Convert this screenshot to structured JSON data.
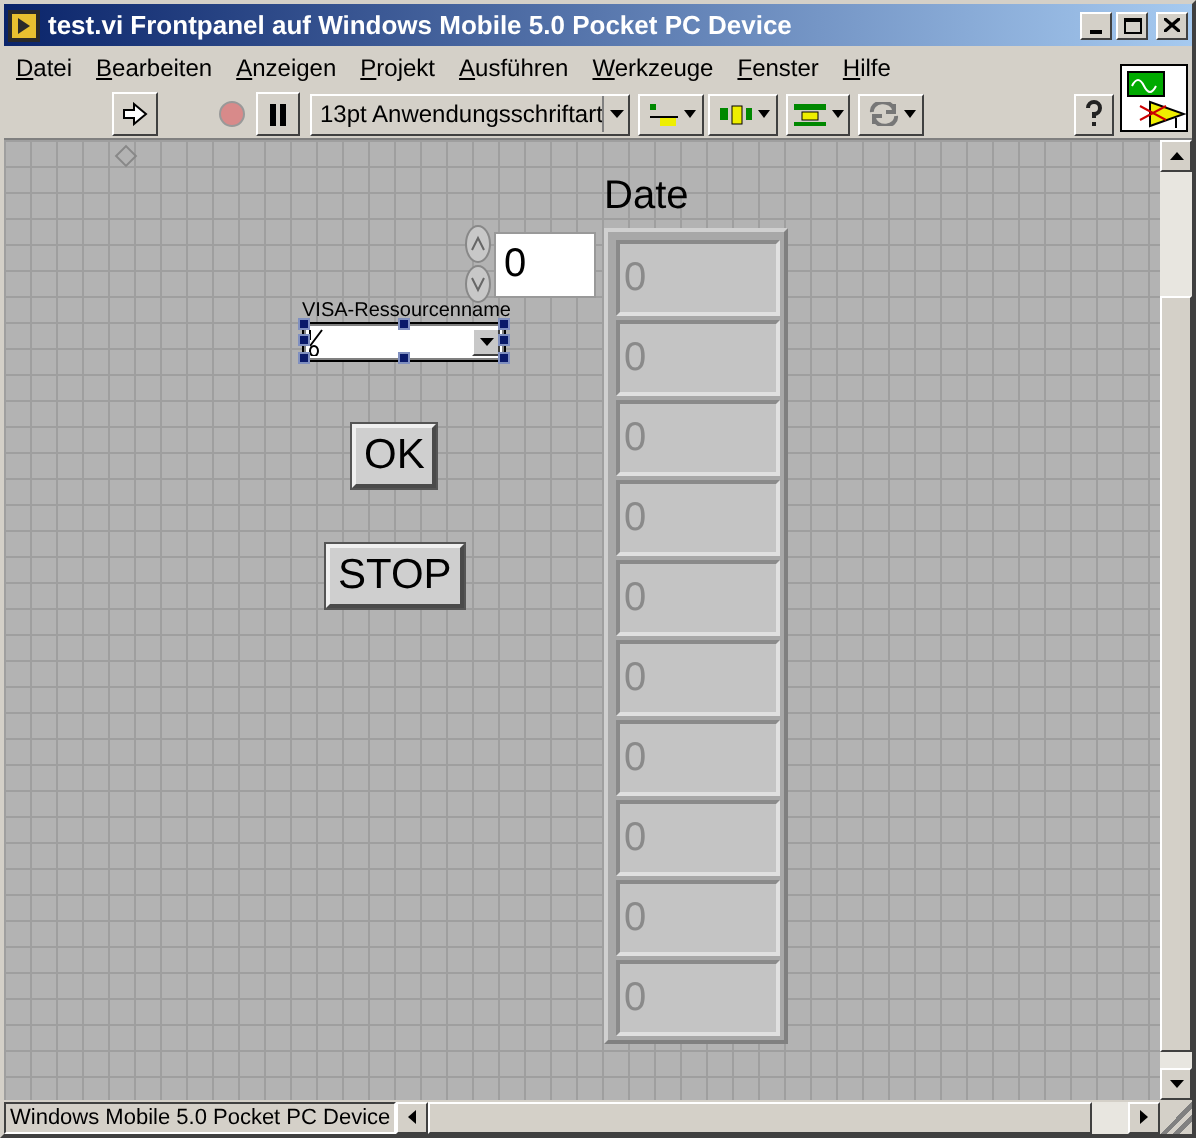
{
  "window": {
    "title": "test.vi Frontpanel auf Windows Mobile 5.0 Pocket PC Device"
  },
  "menu": [
    "Datei",
    "Bearbeiten",
    "Anzeigen",
    "Projekt",
    "Ausführen",
    "Werkzeuge",
    "Fenster",
    "Hilfe"
  ],
  "toolbar": {
    "font": "13pt Anwendungsschriftart"
  },
  "visa": {
    "label": "VISA-Ressourcenname",
    "selected": true
  },
  "buttons": [
    "OK",
    "STOP"
  ],
  "array": {
    "label": "Date",
    "index": "0",
    "elements": [
      "0",
      "0",
      "0",
      "0",
      "0",
      "0",
      "0",
      "0",
      "0",
      "0"
    ]
  },
  "status_bar": "Windows Mobile 5.0 Pocket PC Device"
}
